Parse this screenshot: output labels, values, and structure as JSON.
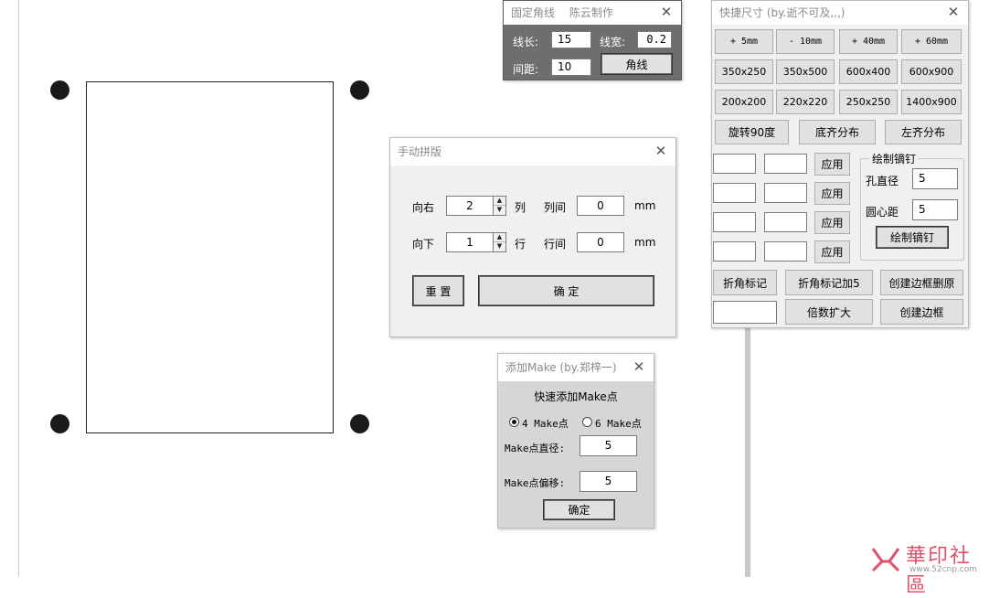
{
  "corner_dialog": {
    "title": "固定角线",
    "author": "陈云制作",
    "length_label": "线长:",
    "length_value": "15",
    "width_label": "线宽:",
    "width_value": "0.2",
    "spacing_label": "间距:",
    "spacing_value": "10",
    "apply_button": "角线"
  },
  "quick_size": {
    "title": "快捷尺寸 (by.逝不可及,,,)",
    "row1": [
      "+ 5mm",
      "- 10mm",
      "+ 40mm",
      "+ 60mm"
    ],
    "row2": [
      "350x250",
      "350x500",
      "600x400",
      "600x900"
    ],
    "row3": [
      "200x200",
      "220x220",
      "250x250",
      "1400x900"
    ],
    "row4": [
      "旋转90度",
      "底齐分布",
      "左齐分布"
    ],
    "apply_label": "应用",
    "rivet_group": "绘制镝钉",
    "hole_label": "孔直径",
    "hole_value": "5",
    "center_label": "圆心距",
    "center_value": "5",
    "draw_rivet_button": "绘制镝钉",
    "row_marks": [
      "折角标记",
      "折角标记加5",
      "创建边框删原"
    ],
    "multiply_button": "倍数扩大",
    "create_border_button": "创建边框"
  },
  "manual_layout": {
    "title": "手动拼版",
    "right_label": "向右",
    "right_value": "2",
    "col_unit": "列",
    "col_gap_label": "列间",
    "col_gap_value": "0",
    "down_label": "向下",
    "down_value": "1",
    "row_unit": "行",
    "row_gap_label": "行间",
    "row_gap_value": "0",
    "mm": "mm",
    "reset_button": "重 置",
    "ok_button": "确 定"
  },
  "make_dialog": {
    "title": "添加Make (by.郑梓一)",
    "heading": "快速添加Make点",
    "option_4": "4 Make点",
    "option_6": "6 Make点",
    "diameter_label": "Make点直径:",
    "diameter_value": "5",
    "offset_label": "Make点偏移:",
    "offset_value": "5",
    "ok_button": "确定"
  },
  "watermark": {
    "text": "華印社區",
    "url": "www.52cnp.com"
  }
}
